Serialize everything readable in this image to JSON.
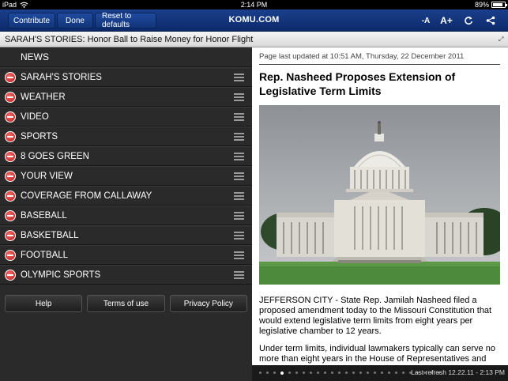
{
  "status_bar": {
    "device": "iPad",
    "time": "2:14 PM",
    "battery": "89%",
    "battery_level": 0.89
  },
  "toolbar": {
    "contribute_label": "Contribute",
    "done_label": "Done",
    "reset_label": "Reset to defaults",
    "brand": "KOMU.COM",
    "font_smaller_label": "-A",
    "font_larger_label": "A+",
    "refresh_icon": "refresh-icon",
    "share_icon": "share-icon"
  },
  "ticker": {
    "text": "SARAH'S STORIES:  Honor Ball to Raise Money for Honor Flight",
    "expand_icon": "expand-icon"
  },
  "sections": {
    "header": "NEWS",
    "items": [
      {
        "label": "SARAH'S STORIES"
      },
      {
        "label": "WEATHER"
      },
      {
        "label": "VIDEO"
      },
      {
        "label": "SPORTS"
      },
      {
        "label": "8 GOES GREEN"
      },
      {
        "label": "YOUR VIEW"
      },
      {
        "label": "COVERAGE FROM CALLAWAY"
      },
      {
        "label": "BASEBALL"
      },
      {
        "label": "BASKETBALL"
      },
      {
        "label": "FOOTBALL"
      },
      {
        "label": "OLYMPIC SPORTS"
      }
    ]
  },
  "footer": {
    "help_label": "Help",
    "terms_label": "Terms of use",
    "privacy_label": "Privacy Policy"
  },
  "article": {
    "updated": "Page last updated at 10:51 AM, Thursday, 22 December 2011",
    "headline": "Rep. Nasheed Proposes Extension of Legislative Term Limits",
    "image_alt": "US Capitol building",
    "paragraph1": "JEFFERSON CITY - State Rep. Jamilah Nasheed filed a proposed amendment today to the Missouri Constitution that would extend legislative term limits from eight years per legislative chamber to 12 years.",
    "paragraph2": "Under term limits, individual lawmakers typically can serve no more than eight years in the House of Representatives and"
  },
  "pager": {
    "total_pages": 26,
    "current_index": 3,
    "last_refresh": "Last refresh 12.22.11 - 2:13 PM"
  },
  "colors": {
    "toolbar": "#0b2a6a",
    "delete": "#c31818",
    "pane": "#2a2a2a"
  }
}
